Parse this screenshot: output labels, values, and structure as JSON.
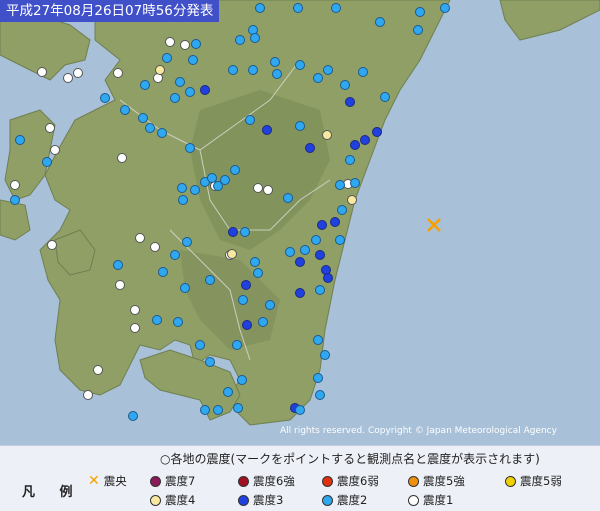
{
  "title": "平成27年08月26日07時56分発表",
  "copyright": "All rights reserved. Copyright © Japan Meteorological Agency",
  "legend": {
    "heading": "各地の震度(マークをポイントすると観測点名と震度が表示されます)",
    "label": "凡 例",
    "epicenter": "震央",
    "items": [
      {
        "label": "震度7",
        "color": "#8a1a5a"
      },
      {
        "label": "震度6強",
        "color": "#a01020"
      },
      {
        "label": "震度6弱",
        "color": "#e03010"
      },
      {
        "label": "震度5強",
        "color": "#f09010"
      },
      {
        "label": "震度5弱",
        "color": "#f0d000"
      },
      {
        "label": "震度4",
        "color": "#f8e8a0"
      },
      {
        "label": "震度3",
        "color": "#2040e0"
      },
      {
        "label": "震度2",
        "color": "#30a8f0"
      },
      {
        "label": "震度1",
        "color": "#ffffff"
      }
    ]
  },
  "colors": {
    "sea": "#a8c0d8",
    "land": "#8a9a60",
    "epicenter": "#f5a000"
  }
}
